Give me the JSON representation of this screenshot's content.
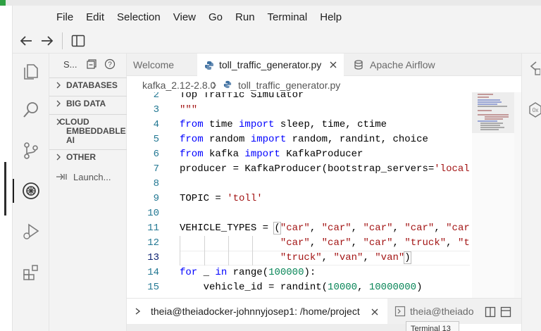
{
  "menubar": {
    "items": [
      "File",
      "Edit",
      "Selection",
      "View",
      "Go",
      "Run",
      "Terminal",
      "Help"
    ]
  },
  "sidebar": {
    "title": "S...",
    "sections": [
      "DATABASES",
      "BIG DATA",
      "CLOUD EMBEDDABLE AI",
      "OTHER"
    ],
    "launch_label": "Launch..."
  },
  "tabs": [
    {
      "label": "Welcome",
      "active": false
    },
    {
      "label": "toll_traffic_generator.py",
      "active": true
    },
    {
      "label": "Apache Airflow",
      "active": false
    }
  ],
  "breadcrumb": {
    "folder": "kafka_2.12-2.8.0",
    "file": "toll_traffic_generator.py"
  },
  "editor": {
    "lines": [
      {
        "n": "2",
        "segs": [
          [
            "c",
            "Top Traffic Simulator"
          ]
        ]
      },
      {
        "n": "3",
        "segs": [
          [
            "s",
            "\"\"\""
          ]
        ]
      },
      {
        "n": "4",
        "segs": [
          [
            "k",
            "from"
          ],
          [
            "c",
            " time "
          ],
          [
            "k",
            "import"
          ],
          [
            "c",
            " sleep, time, ctime"
          ]
        ]
      },
      {
        "n": "5",
        "segs": [
          [
            "k",
            "from"
          ],
          [
            "c",
            " random "
          ],
          [
            "k",
            "import"
          ],
          [
            "c",
            " random, randint, choice"
          ]
        ]
      },
      {
        "n": "6",
        "segs": [
          [
            "k",
            "from"
          ],
          [
            "c",
            " kafka "
          ],
          [
            "k",
            "import"
          ],
          [
            "c",
            " KafkaProducer"
          ]
        ]
      },
      {
        "n": "7",
        "segs": [
          [
            "c",
            "producer = KafkaProducer(bootstrap_servers="
          ],
          [
            "s",
            "'local"
          ]
        ]
      },
      {
        "n": "8",
        "segs": []
      },
      {
        "n": "9",
        "segs": [
          [
            "c",
            "TOPIC = "
          ],
          [
            "s",
            "'toll'"
          ]
        ]
      },
      {
        "n": "10",
        "segs": []
      },
      {
        "n": "11",
        "segs": [
          [
            "c",
            "VEHICLE_TYPES = "
          ],
          [
            "b",
            "("
          ],
          [
            "s",
            "\"car\""
          ],
          [
            "c",
            ", "
          ],
          [
            "s",
            "\"car\""
          ],
          [
            "c",
            ", "
          ],
          [
            "s",
            "\"car\""
          ],
          [
            "c",
            ", "
          ],
          [
            "s",
            "\"car\""
          ],
          [
            "c",
            ", "
          ],
          [
            "s",
            "\"car"
          ]
        ]
      },
      {
        "n": "12",
        "segs": [
          [
            "c",
            "                 "
          ],
          [
            "s",
            "\"car\""
          ],
          [
            "c",
            ", "
          ],
          [
            "s",
            "\"car\""
          ],
          [
            "c",
            ", "
          ],
          [
            "s",
            "\"car\""
          ],
          [
            "c",
            ", "
          ],
          [
            "s",
            "\"truck\""
          ],
          [
            "c",
            ", "
          ],
          [
            "s",
            "\"t"
          ]
        ]
      },
      {
        "n": "13",
        "segs": [
          [
            "c",
            "                 "
          ],
          [
            "s",
            "\"truck\""
          ],
          [
            "c",
            ", "
          ],
          [
            "s",
            "\"van\""
          ],
          [
            "c",
            ", "
          ],
          [
            "s",
            "\"van\""
          ],
          [
            "b",
            ")"
          ]
        ]
      },
      {
        "n": "14",
        "segs": [
          [
            "k",
            "for"
          ],
          [
            "c",
            " _ "
          ],
          [
            "k",
            "in"
          ],
          [
            "c",
            " range("
          ],
          [
            "num",
            "100000"
          ],
          [
            "c",
            "):"
          ]
        ]
      },
      {
        "n": "15",
        "segs": [
          [
            "c",
            "    vehicle_id = randint("
          ],
          [
            "num",
            "10000"
          ],
          [
            "c",
            ", "
          ],
          [
            "num",
            "10000000"
          ],
          [
            "c",
            ")"
          ]
        ]
      }
    ]
  },
  "terminal": {
    "tabs": [
      {
        "label": "theia@theiadocker-johnnyjosep1: /home/project",
        "active": true
      },
      {
        "label": "theia@theiado",
        "active": false
      }
    ],
    "tooltip": "Terminal 13"
  }
}
